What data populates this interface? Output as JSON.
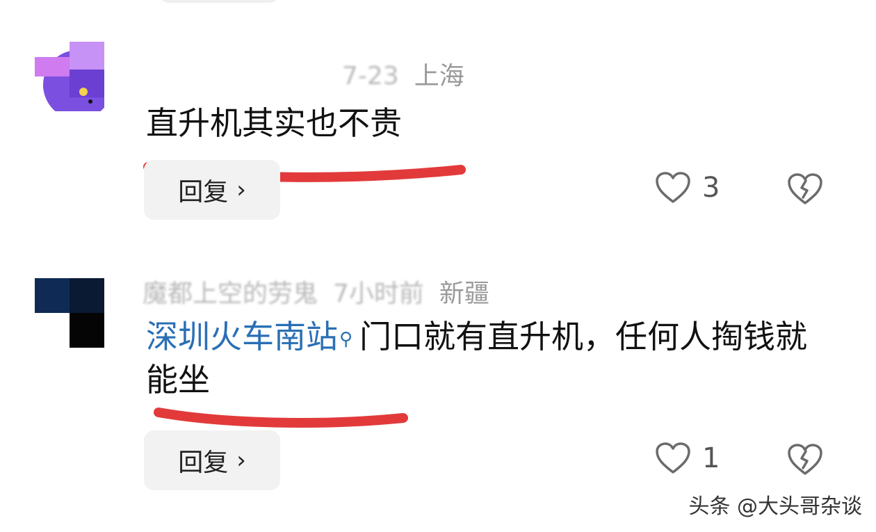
{
  "comments": [
    {
      "meta_date_partial": "7-23",
      "location": "上海",
      "text": "直升机其实也不贵",
      "reply_label": "回复",
      "like_count": "3"
    },
    {
      "username_blurred": "魔都上空的劳鬼",
      "time_blurred": "7小时前",
      "location": "新疆",
      "topic_link": "深圳火车南站",
      "text": "门口就有直升机，任何人掏钱就能坐",
      "reply_label": "回复",
      "like_count": "1"
    }
  ],
  "watermark": "头条 @大头哥杂谈",
  "colors": {
    "link": "#2a6fb5",
    "underline": "#e23a3a",
    "reply_bg": "#f2f2f2",
    "meta_text": "#9a9a9a"
  },
  "icons": [
    "heart-outline-icon",
    "broken-heart-icon",
    "chevron-right-icon",
    "search-icon"
  ]
}
